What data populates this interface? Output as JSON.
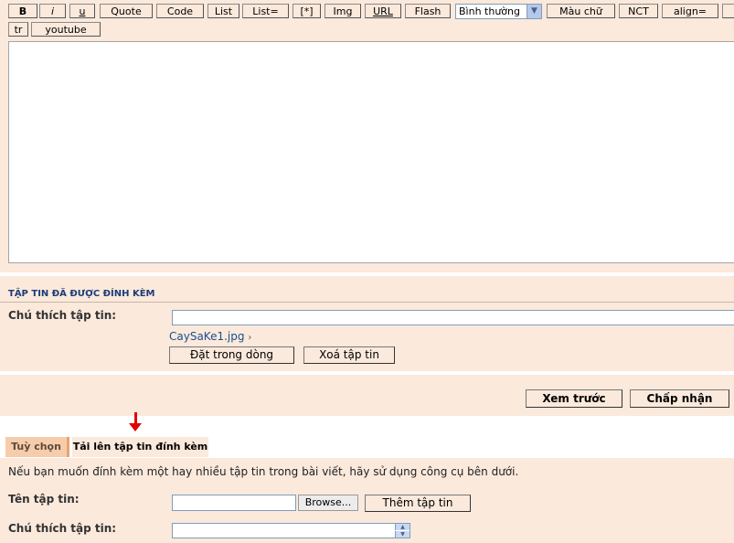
{
  "toolbar": {
    "row1": [
      "B",
      "i",
      "u",
      "Quote",
      "Code",
      "List",
      "List=",
      "[*]",
      "Img",
      "URL",
      "Flash"
    ],
    "font_size_select": "Bình thường",
    "row1_after": [
      "Màu chữ",
      "NCT",
      "align="
    ],
    "row2": [
      "tr",
      "youtube"
    ]
  },
  "attachments": {
    "title": "TẬP TIN ĐÃ ĐƯỢC ĐÍNH KÈM",
    "comment_label": "Chú thích tập tin:",
    "file_name": "CaySaKe1.jpg",
    "file_marker": "›",
    "inline_button": "Đặt trong dòng",
    "delete_button": "Xoá tập tin"
  },
  "actions": {
    "preview": "Xem trước",
    "submit": "Chấp nhận"
  },
  "tabs": {
    "options": "Tuỳ chọn",
    "upload": "Tải lên tập tin đính kèm"
  },
  "upload": {
    "intro": "Nếu bạn muốn đính kèm một hay nhiều tập tin trong bài viết, hãy sử dụng công cụ bên dưới.",
    "file_label": "Tên tập tin:",
    "browse_button": "Browse...",
    "add_button": "Thêm tập tin",
    "comment_label": "Chú thích tập tin:"
  }
}
